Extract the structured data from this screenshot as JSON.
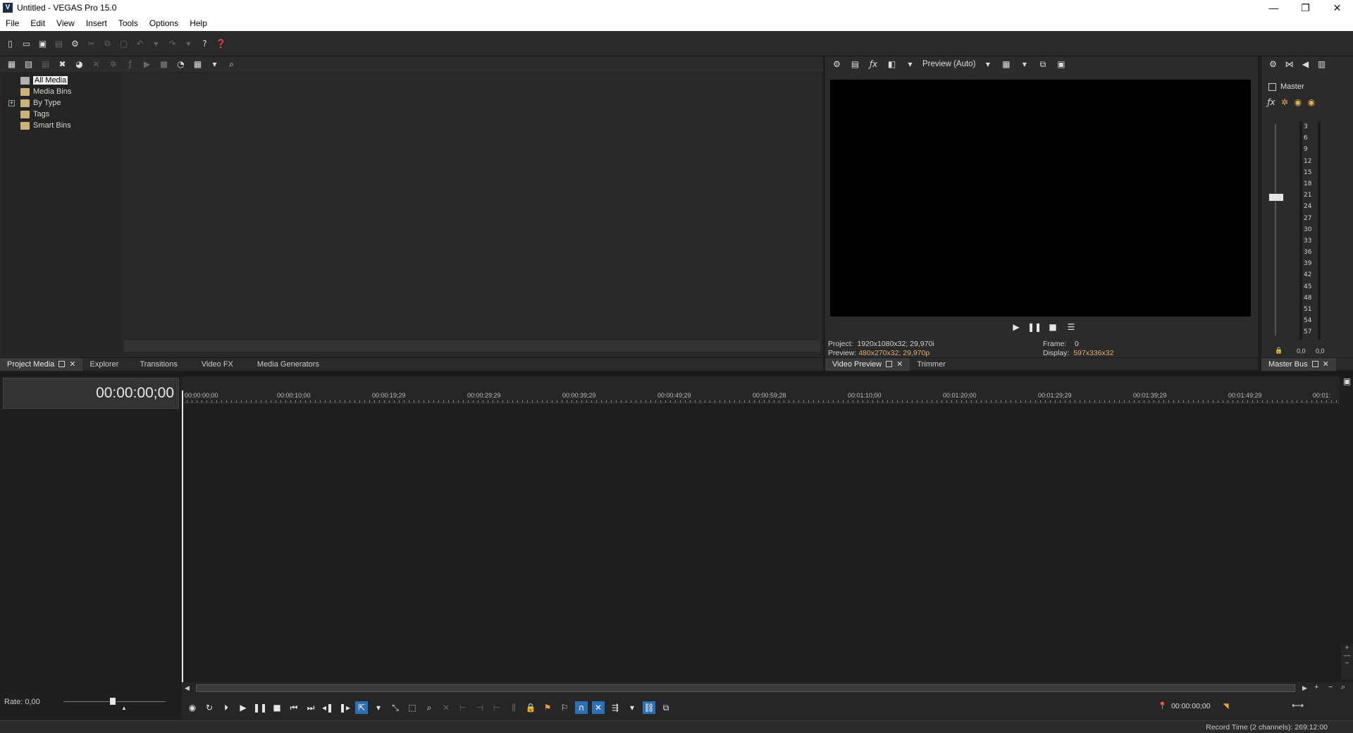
{
  "window": {
    "title": "Untitled - VEGAS Pro 15.0",
    "app_icon_letter": "V",
    "minimize": "—",
    "restore": "❐",
    "close": "✕"
  },
  "menu": [
    "File",
    "Edit",
    "View",
    "Insert",
    "Tools",
    "Options",
    "Help"
  ],
  "project_media": {
    "tree": [
      {
        "label": "All Media",
        "selected": true
      },
      {
        "label": "Media Bins"
      },
      {
        "label": "By Type",
        "expander": "+"
      },
      {
        "label": "Tags"
      },
      {
        "label": "Smart Bins"
      }
    ]
  },
  "left_tabs": [
    {
      "label": "Project Media",
      "active": true
    },
    {
      "label": "Explorer"
    },
    {
      "label": "Transitions"
    },
    {
      "label": "Video FX"
    },
    {
      "label": "Media Generators"
    }
  ],
  "preview": {
    "quality": "Preview (Auto)",
    "project_label": "Project:",
    "project_value": "1920x1080x32; 29,970i",
    "preview_label": "Preview:",
    "preview_value": "480x270x32; 29,970p",
    "frame_label": "Frame:",
    "frame_value": "0",
    "display_label": "Display:",
    "display_value": "597x336x32",
    "tabs": [
      {
        "label": "Video Preview",
        "active": true
      },
      {
        "label": "Trimmer"
      }
    ]
  },
  "master": {
    "label": "Master",
    "scale": [
      "3",
      "6",
      "9",
      "12",
      "15",
      "18",
      "21",
      "24",
      "27",
      "30",
      "33",
      "36",
      "39",
      "42",
      "45",
      "48",
      "51",
      "54",
      "57"
    ],
    "left_value": "0,0",
    "right_value": "0,0",
    "tab": "Master Bus"
  },
  "timeline": {
    "timecode": "00:00:00;00",
    "ruler": [
      "00:00:00;00",
      "00:00:10;00",
      "00:00:19;29",
      "00:00:29;29",
      "00:00:39;29",
      "00:00:49;29",
      "00:00:59;28",
      "00:01:10;00",
      "00:01:20;00",
      "00:01:29;29",
      "00:01:39;29",
      "00:01:49;29",
      "00:01:"
    ],
    "rate": "Rate: 0,00",
    "cursor_time": "00:00:00;00"
  },
  "status": {
    "record_time": "Record Time (2 channels): 269:12:00"
  }
}
